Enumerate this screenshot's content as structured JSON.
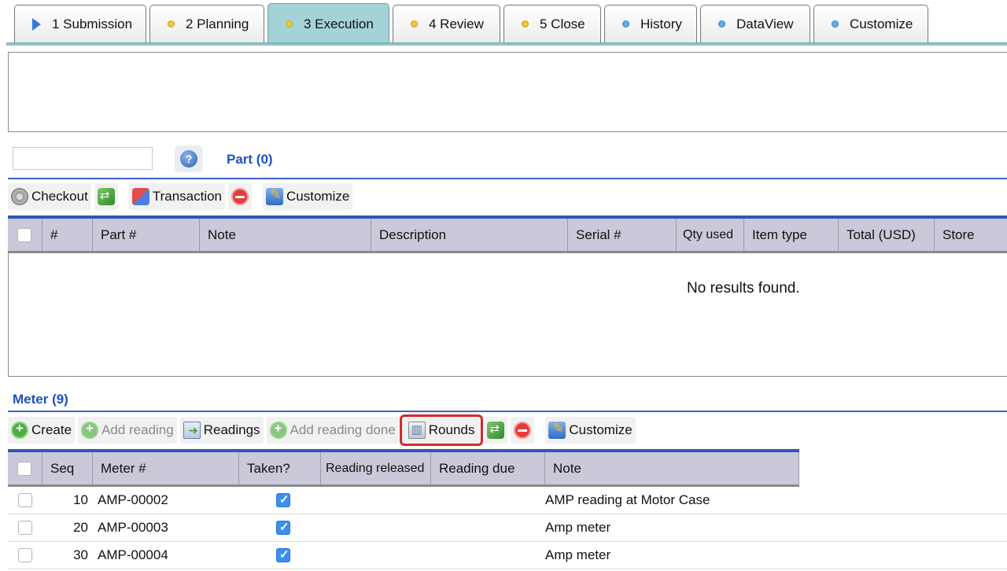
{
  "tabs": [
    {
      "label": "1 Submission",
      "icon": "triangle-right-icon",
      "active": false
    },
    {
      "label": "2 Planning",
      "icon": "yellow-dot-icon",
      "active": false
    },
    {
      "label": "3 Execution",
      "icon": "yellow-dot-icon",
      "active": true
    },
    {
      "label": "4 Review",
      "icon": "yellow-dot-icon",
      "active": false
    },
    {
      "label": "5 Close",
      "icon": "yellow-dot-icon",
      "active": false
    },
    {
      "label": "History",
      "icon": "blue-dot-icon",
      "active": false
    },
    {
      "label": "DataView",
      "icon": "blue-dot-icon",
      "active": false
    },
    {
      "label": "Customize",
      "icon": "blue-dot-icon",
      "active": false
    }
  ],
  "part": {
    "search_value": "",
    "title": "Part (0)",
    "toolbar": {
      "checkout": "Checkout",
      "transaction": "Transaction",
      "customize": "Customize"
    },
    "columns": [
      "#",
      "Part #",
      "Note",
      "Description",
      "Serial #",
      "Qty used",
      "Item type",
      "Total (USD)",
      "Store"
    ],
    "empty_message": "No results found."
  },
  "meter": {
    "title": "Meter (9)",
    "toolbar": {
      "create": "Create",
      "add_reading": "Add reading",
      "readings": "Readings",
      "add_reading_done": "Add reading done",
      "rounds": "Rounds",
      "customize": "Customize"
    },
    "columns": [
      "Seq",
      "Meter #",
      "Taken?",
      "Reading released",
      "Reading due",
      "Note"
    ],
    "rows": [
      {
        "seq": "10",
        "meter": "AMP-00002",
        "taken": true,
        "note": "AMP reading at Motor Case"
      },
      {
        "seq": "20",
        "meter": "AMP-00003",
        "taken": true,
        "note": "Amp meter"
      },
      {
        "seq": "30",
        "meter": "AMP-00004",
        "taken": true,
        "note": "Amp meter"
      }
    ]
  },
  "colors": {
    "accent_blue": "#1f4fc2",
    "active_tab": "#a3d3d6",
    "highlight": "#d42a2a",
    "grid_header": "#c9c9d9"
  }
}
